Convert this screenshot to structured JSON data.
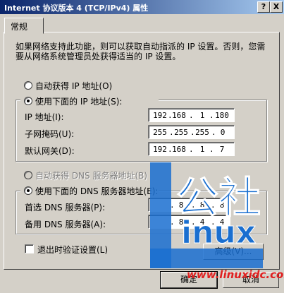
{
  "window": {
    "title": "Internet 协议版本 4 (TCP/IPv4) 属性",
    "help_label": "?",
    "close_label": "X"
  },
  "tabs": [
    {
      "label": "常规"
    }
  ],
  "description": "如果网络支持此功能，则可以获取自动指派的 IP 设置。否则，您需要从网络系统管理员处获得适当的 IP 设置。",
  "ip": {
    "auto_label": "自动获得 IP 地址(O)",
    "manual_label": "使用下面的 IP 地址(S):",
    "address_label": "IP 地址(I):",
    "address": [
      "192",
      "168",
      "1",
      "180"
    ],
    "mask_label": "子网掩码(U):",
    "mask": [
      "255",
      "255",
      "255",
      "0"
    ],
    "gateway_label": "默认网关(D):",
    "gateway": [
      "192",
      "168",
      "1",
      "7"
    ]
  },
  "dns": {
    "auto_label": "自动获得 DNS 服务器地址(B)",
    "manual_label": "使用下面的 DNS 服务器地址(E):",
    "preferred_label": "首选 DNS 服务器(P):",
    "preferred": [
      "",
      "8",
      "8",
      "8"
    ],
    "alternate_label": "备用 DNS 服务器(A):",
    "alternate": [
      "",
      "8",
      "4",
      "4"
    ]
  },
  "validate_label": "退出时验证设置(L)",
  "advanced_label": "高级(V)...",
  "ok_label": "确定",
  "cancel_label": "取消",
  "watermark": {
    "cn_text": "公社",
    "linux_text": "inux",
    "url": "www.linuxidc.com",
    "color": "#1a6fd0"
  }
}
